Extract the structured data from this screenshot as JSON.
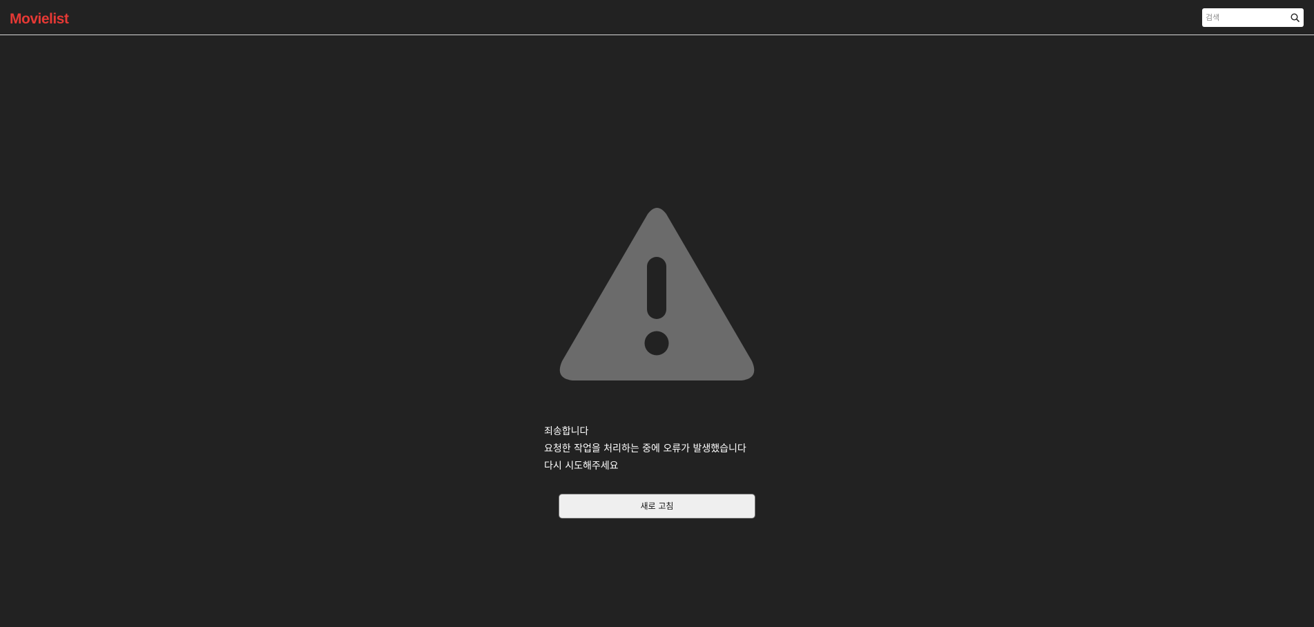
{
  "header": {
    "logo_text": "Movielist",
    "search": {
      "placeholder": "검색",
      "value": ""
    },
    "search_icon": "search-icon"
  },
  "error": {
    "icon": "warning-icon",
    "lines": [
      "죄송합니다",
      "요청한 작업을 처리하는 중에 오류가 발생했습니다",
      "다시 시도해주세요"
    ],
    "refresh_label": "새로 고침"
  },
  "colors": {
    "background": "#222222",
    "brand": "#e53935",
    "icon": "#6b6b6b",
    "button": "#efefef"
  }
}
